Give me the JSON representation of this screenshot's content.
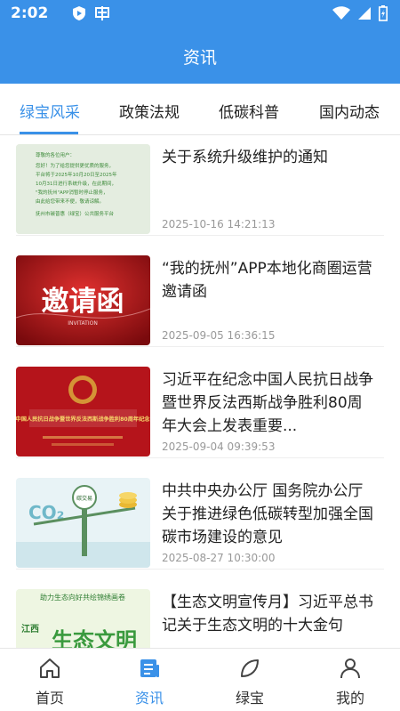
{
  "status_bar": {
    "time": "2:02",
    "icons": [
      "play-shield-icon",
      "app-notification-icon",
      "wifi-icon",
      "signal-icon",
      "battery-icon"
    ]
  },
  "header": {
    "title": "资讯"
  },
  "tabs": [
    {
      "label": "绿宝风采",
      "active": true
    },
    {
      "label": "政策法规",
      "active": false
    },
    {
      "label": "低碳科普",
      "active": false
    },
    {
      "label": "国内动态",
      "active": false
    }
  ],
  "news": [
    {
      "title": "关于系统升级维护的通知",
      "date": "2025-10-16 14:21:13",
      "thumb": {
        "lines": [
          "尊敬的各位用户：",
          "您好！为了给您提供更优质的服务，",
          "平台将于2025年10月20日至2025年",
          "10月31日进行系统升级，在此期间，",
          "\"我的抚州\"APP消暂时停止服务，",
          "由此给您带来不便，敬请谅解。",
          "抚州市碳普惠（绿宝）公共服务平台"
        ]
      }
    },
    {
      "title": "“我的抚州”APP本地化商圈运营邀请函",
      "date": "2025-09-05 16:36:15",
      "thumb": {
        "big": "邀请函",
        "small": "INVITATION"
      }
    },
    {
      "title": "习近平在纪念中国人民抗日战争暨世界反法西斯战争胜利80周年大会上发表重要...",
      "date": "2025-09-04 09:39:53",
      "thumb": {
        "banner": "中国人民抗日战争暨世界反法西斯战争胜利80周年纪念"
      }
    },
    {
      "title": "中共中央办公厅 国务院办公厅关于推进绿色低碳转型加强全国碳市场建设的意见",
      "date": "2025-08-27 10:30:00",
      "thumb": {
        "co2": "CO₂",
        "badge": "碳交易"
      }
    },
    {
      "title": "【生态文明宣传月】习近平总书记关于生态文明的十大金句",
      "date": "",
      "thumb": {
        "top": "助力生态向好共绘锦绣画卷",
        "big": "生态文明",
        "side": "江西"
      }
    }
  ],
  "tabbar": [
    {
      "label": "首页",
      "icon": "home-icon",
      "active": false
    },
    {
      "label": "资讯",
      "icon": "news-icon",
      "active": true
    },
    {
      "label": "绿宝",
      "icon": "leaf-icon",
      "active": false
    },
    {
      "label": "我的",
      "icon": "user-icon",
      "active": false
    }
  ],
  "colors": {
    "primary": "#3a91e8",
    "text": "#222222",
    "date": "#999999"
  }
}
